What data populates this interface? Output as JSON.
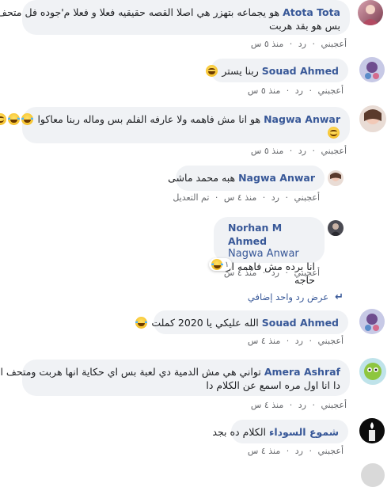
{
  "comments": [
    {
      "name": "Atota Tota",
      "lines": [
        "هو يجماعه بتهزر هي اصلا القصه حقيقيه فعلا و فعلا م'جوده فل متحف",
        "بس هو بقد هربت"
      ],
      "meta": {
        "like": "أعجبني",
        "reply": "رد",
        "time": "منذ ٥ س"
      }
    },
    {
      "name": "Souad Ahmed",
      "text": "ربنا يستر",
      "meta": {
        "like": "أعجبني",
        "reply": "رد",
        "time": "منذ ٥ س"
      }
    },
    {
      "name": "Nagwa Anwar",
      "text": "هو انا مش فاهمه ولا عارفه الفلم بس وماله ربنا معاكوا",
      "meta": {
        "like": "أعجبني",
        "reply": "رد",
        "time": "منذ ٥ س"
      }
    },
    {
      "name": "Nagwa Anwar",
      "text": "هبه محمد ماشى",
      "meta": {
        "like": "أعجبني",
        "reply": "رد",
        "time": "منذ ٤ س",
        "edited": "تم التعديل"
      }
    },
    {
      "name": "Norhan M Ahmed",
      "mention": "Nagwa Anwar",
      "text": "انا برده مش فاهمه اي حاجه",
      "reaction_count": "١",
      "meta": {
        "like": "أعجبني",
        "reply": "رد",
        "time": "منذ ٤ س"
      }
    },
    {
      "name": "Souad Ahmed",
      "text": "الله عليكي يا 2020 كملت",
      "meta": {
        "like": "أعجبني",
        "reply": "رد",
        "time": "منذ ٤ س"
      }
    },
    {
      "name": "Amera Ashraf",
      "lines": [
        "تواني هي مش الدمية دي لعبة بس اي حكاية انها هربت ومتحف اي",
        "دا انا اول مره اسمع عن الكلام دا"
      ],
      "meta": {
        "like": "أعجبني",
        "reply": "رد",
        "time": "منذ ٤ س"
      }
    },
    {
      "name": "شموع السوداء",
      "text": "الكلام ده بجد",
      "meta": {
        "like": "أعجبني",
        "reply": "رد",
        "time": "منذ ٤ س"
      }
    }
  ],
  "more_replies": "عرض رد واحد إضافي",
  "separator": "·"
}
